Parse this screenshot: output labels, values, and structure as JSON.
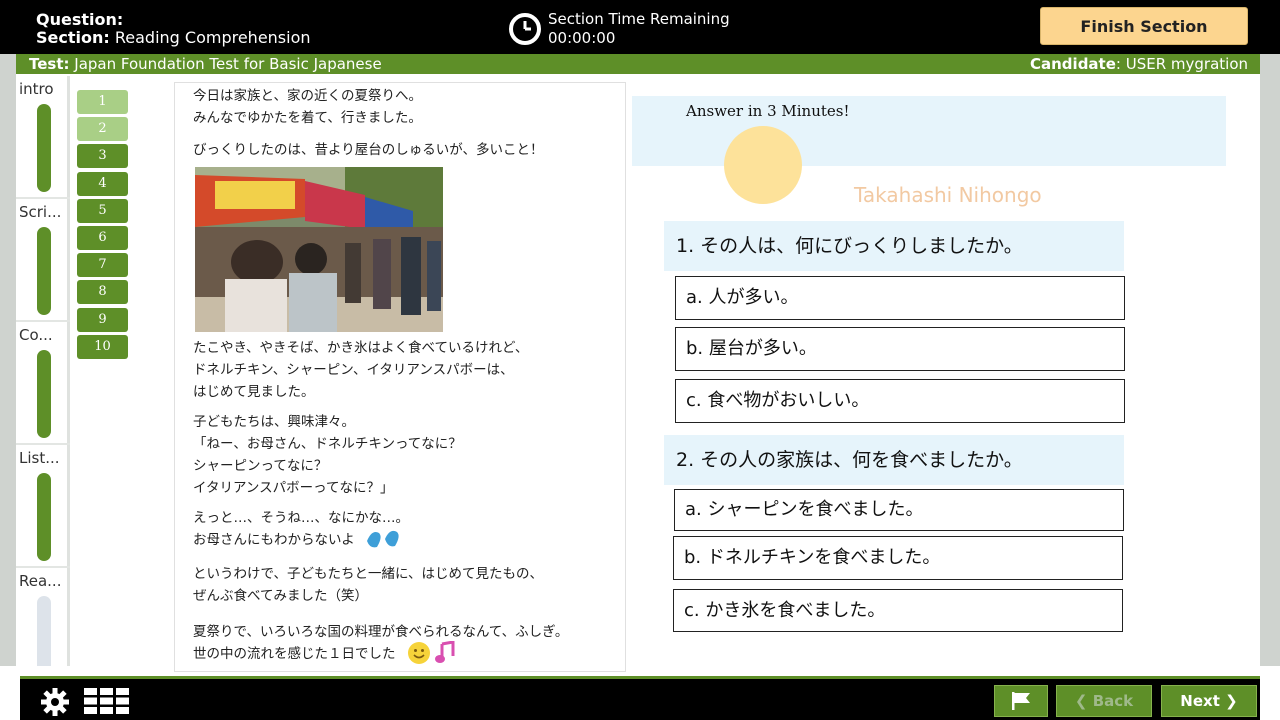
{
  "header": {
    "question_label": "Question:",
    "section_label": "Section:",
    "section_value": "Reading Comprehension",
    "timer_title": "Section Time Remaining",
    "timer_value": "00:00:00",
    "finish_label": "Finish Section"
  },
  "testbar": {
    "test_label": "Test:",
    "test_value": "Japan Foundation Test for Basic Japanese",
    "candidate_label": "Candidate",
    "candidate_value": ": USER mygration"
  },
  "rail": {
    "items": [
      {
        "label": "intro",
        "color": "#5e8f28"
      },
      {
        "label": "Scri...",
        "color": "#5e8f28"
      },
      {
        "label": "Co...",
        "color": "#5e8f28"
      },
      {
        "label": "List...",
        "color": "#5e8f28"
      },
      {
        "label": "Rea...",
        "color": "#dde3ea"
      }
    ]
  },
  "questions": {
    "numbers": [
      "1",
      "2",
      "3",
      "4",
      "5",
      "6",
      "7",
      "8",
      "9",
      "10"
    ],
    "done_color": "#a9cf86",
    "todo_color": "#5e8f28"
  },
  "passage": {
    "lines": [
      "今日は家族と、家の近くの夏祭りへ。\nみんなでゆかたを着て、行きました。",
      "びっくりしたのは、昔より屋台のしゅるいが、多いこと！",
      "たこやき、やきそば、かき氷はよく食べているけれど、\nドネルチキン、シャーピン、イタリアンスパボーは、\nはじめて見ました。",
      "子どもたちは、興味津々。\n「ねー、お母さん、ドネルチキンってなに？\nシャーピンってなに？\nイタリアンスパボーってなに？」",
      "えっと…、そうね…、なにかな…。\nお母さんにもわからないよ",
      "というわけで、子どもたちと一緒に、はじめて見たもの、\nぜんぶ食べてみました（笑）",
      "夏祭りで、いろいろな国の料理が食べられるなんて、ふしぎ。\n世の中の流れを感じた１日でした"
    ]
  },
  "right": {
    "banner": "Answer in 3 Minutes!",
    "logo_text": "Takahashi Nihongo",
    "q1": {
      "text": "1. その人は、何にびっくりしましたか。",
      "options": [
        "a. 人が多い。",
        "b. 屋台が多い。",
        "c. 食べ物がおいしい。"
      ]
    },
    "q2": {
      "text": "2. その人の家族は、何を食べましたか。",
      "options": [
        "a. シャーピンを食べました。",
        "b. ドネルチキンを食べました。",
        "c. かき氷を食べました。"
      ]
    }
  },
  "footer": {
    "back_label": "Back",
    "next_label": "Next"
  }
}
